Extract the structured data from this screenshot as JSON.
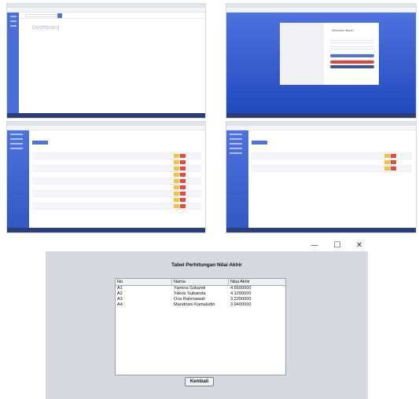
{
  "dashboard_screen": {
    "heading": "Dashboard"
  },
  "login_screen": {
    "heading": "Welcome Back!"
  },
  "swing_window": {
    "controls": {
      "minimize": "—",
      "maximize": "☐",
      "close": "✕"
    },
    "title": "Tabel Perhitungan Nilai Akhir",
    "table": {
      "columns": [
        "No",
        "Nama",
        "Nilai Akhir"
      ],
      "rows": [
        [
          "A1",
          "Yamina Sukamti",
          "4.5500000"
        ],
        [
          "A2",
          "Yakob Subainda",
          "4.1200000"
        ],
        [
          "A3",
          "Oca Rahmawati",
          "3.2200000"
        ],
        [
          "A4",
          "Mandriani Kamaludin",
          "3.9400000"
        ]
      ]
    },
    "back_button": "Kembali"
  }
}
